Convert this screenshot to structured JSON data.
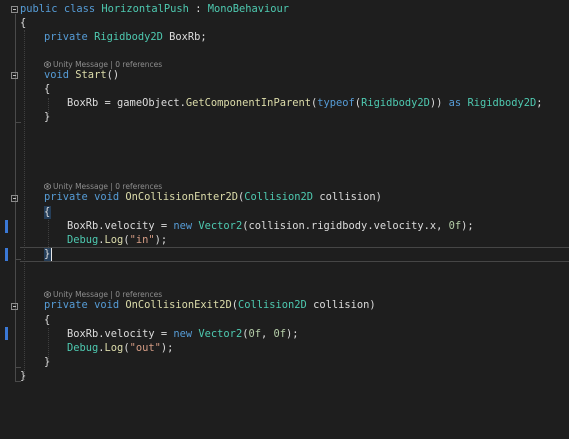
{
  "colors": {
    "background": "#1e1e1e",
    "keyword": "#569cd6",
    "type": "#4ec9b0",
    "method": "#dcdcaa",
    "string": "#d69d85",
    "number": "#b5cea8",
    "text": "#dcdcdc",
    "hint": "#8e8e8e",
    "change_bar": "#3a78d6"
  },
  "code_lens": {
    "start": "Unity Message | 0 references",
    "on_collision_enter": "Unity Message | 0 references",
    "on_collision_exit": "Unity Message | 0 references"
  },
  "code": {
    "l1": {
      "t1": "public",
      "t2": " ",
      "t3": "class",
      "t4": " ",
      "t5": "HorizontalPush",
      "t6": " : ",
      "t7": "MonoBehaviour"
    },
    "l2": {
      "t1": "{"
    },
    "l3": {
      "t1": "private",
      "t2": " ",
      "t3": "Rigidbody2D",
      "t4": " BoxRb;"
    },
    "l4": {
      "t1": "void",
      "t2": " ",
      "t3": "Start",
      "t4": "()"
    },
    "l5": {
      "t1": "{"
    },
    "l6": {
      "t1": "BoxRb = gameObject.",
      "t2": "GetComponentInParent",
      "t3": "(",
      "t4": "typeof",
      "t5": "(",
      "t6": "Rigidbody2D",
      "t7": ")) ",
      "t8": "as",
      "t9": " ",
      "t10": "Rigidbody2D",
      "t11": ";"
    },
    "l7": {
      "t1": "}"
    },
    "l8": {
      "t1": "private",
      "t2": " ",
      "t3": "void",
      "t4": " ",
      "t5": "OnCollisionEnter2D",
      "t6": "(",
      "t7": "Collision2D",
      "t8": " collision)"
    },
    "l9": {
      "t1": "{"
    },
    "l10": {
      "t1": "BoxRb.velocity = ",
      "t2": "new",
      "t3": " ",
      "t4": "Vector2",
      "t5": "(collision.rigidbody.velocity.x, ",
      "t6": "0f",
      "t7": ");"
    },
    "l11": {
      "t1": "Debug",
      "t2": ".",
      "t3": "Log",
      "t4": "(",
      "t5": "\"in\"",
      "t6": ");"
    },
    "l12": {
      "t1": "}"
    },
    "l13": {
      "t1": "private",
      "t2": " ",
      "t3": "void",
      "t4": " ",
      "t5": "OnCollisionExit2D",
      "t6": "(",
      "t7": "Collision2D",
      "t8": " collision)"
    },
    "l14": {
      "t1": "{"
    },
    "l15": {
      "t1": "BoxRb.velocity = ",
      "t2": "new",
      "t3": " ",
      "t4": "Vector2",
      "t5": "(",
      "t6": "0f",
      "t7": ", ",
      "t8": "0f",
      "t9": ");"
    },
    "l16": {
      "t1": "Debug",
      "t2": ".",
      "t3": "Log",
      "t4": "(",
      "t5": "\"out\"",
      "t6": ");"
    },
    "l17": {
      "t1": "}"
    },
    "l18": {
      "t1": "}"
    }
  }
}
